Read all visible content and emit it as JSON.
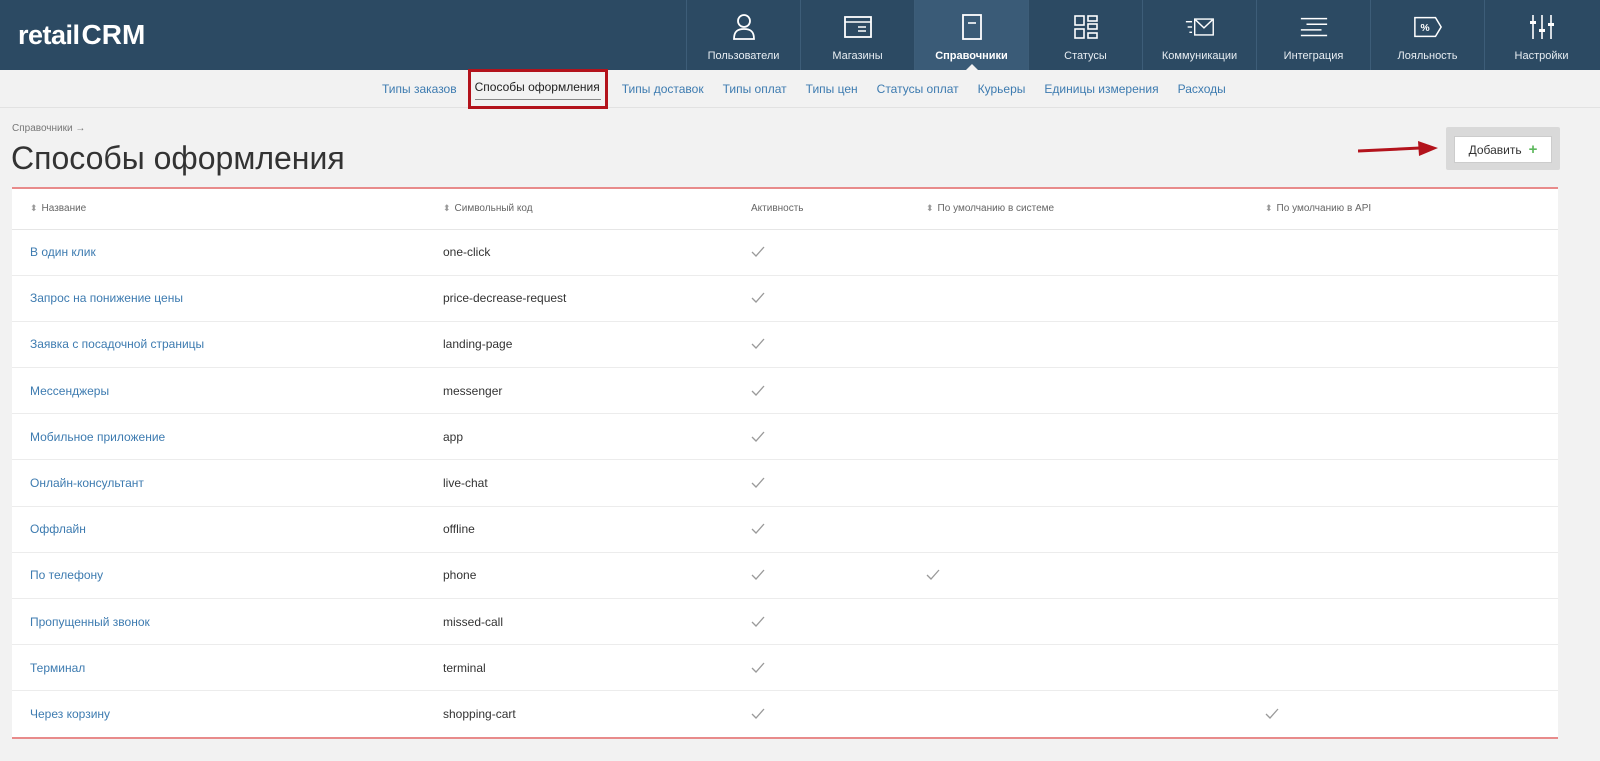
{
  "logo": {
    "text_left": "retail",
    "text_right": "CRM"
  },
  "nav": [
    {
      "label": "Пользователи",
      "icon": "user-icon"
    },
    {
      "label": "Магазины",
      "icon": "store-icon"
    },
    {
      "label": "Справочники",
      "icon": "reference-book-icon",
      "active": true
    },
    {
      "label": "Статусы",
      "icon": "statuses-icon"
    },
    {
      "label": "Коммуникации",
      "icon": "communications-icon"
    },
    {
      "label": "Интеграция",
      "icon": "integration-icon"
    },
    {
      "label": "Лояльность",
      "icon": "loyalty-icon"
    },
    {
      "label": "Настройки",
      "icon": "settings-sliders-icon"
    }
  ],
  "subnav": [
    "Типы заказов",
    "Способы оформления",
    "Типы доставок",
    "Типы оплат",
    "Типы цен",
    "Статусы оплат",
    "Курьеры",
    "Единицы измерения",
    "Расходы"
  ],
  "subnav_active_index": 1,
  "breadcrumb": "Справочники →",
  "page_title": "Способы оформления",
  "add_button": {
    "label": "Добавить",
    "icon": "plus-icon"
  },
  "table": {
    "headers": {
      "name": "Название",
      "code": "Символьный код",
      "active": "Активность",
      "default_system": "По умолчанию в системе",
      "default_api": "По умолчанию в API"
    },
    "rows": [
      {
        "name": "В один клик",
        "code": "one-click",
        "active": true,
        "default_system": false,
        "default_api": false
      },
      {
        "name": "Запрос на понижение цены",
        "code": "price-decrease-request",
        "active": true,
        "default_system": false,
        "default_api": false
      },
      {
        "name": "Заявка с посадочной страницы",
        "code": "landing-page",
        "active": true,
        "default_system": false,
        "default_api": false
      },
      {
        "name": "Мессенджеры",
        "code": "messenger",
        "active": true,
        "default_system": false,
        "default_api": false
      },
      {
        "name": "Мобильное приложение",
        "code": "app",
        "active": true,
        "default_system": false,
        "default_api": false
      },
      {
        "name": "Онлайн-консультант",
        "code": "live-chat",
        "active": true,
        "default_system": false,
        "default_api": false
      },
      {
        "name": "Оффлайн",
        "code": "offline",
        "active": true,
        "default_system": false,
        "default_api": false
      },
      {
        "name": "По телефону",
        "code": "phone",
        "active": true,
        "default_system": true,
        "default_api": false
      },
      {
        "name": "Пропущенный звонок",
        "code": "missed-call",
        "active": true,
        "default_system": false,
        "default_api": false
      },
      {
        "name": "Терминал",
        "code": "terminal",
        "active": true,
        "default_system": false,
        "default_api": false
      },
      {
        "name": "Через корзину",
        "code": "shopping-cart",
        "active": true,
        "default_system": false,
        "default_api": true
      }
    ]
  },
  "colors": {
    "topbar": "#2c4a63",
    "link": "#3d7bb0",
    "highlight_red": "#b3131c",
    "table_border": "#e88b8b"
  }
}
